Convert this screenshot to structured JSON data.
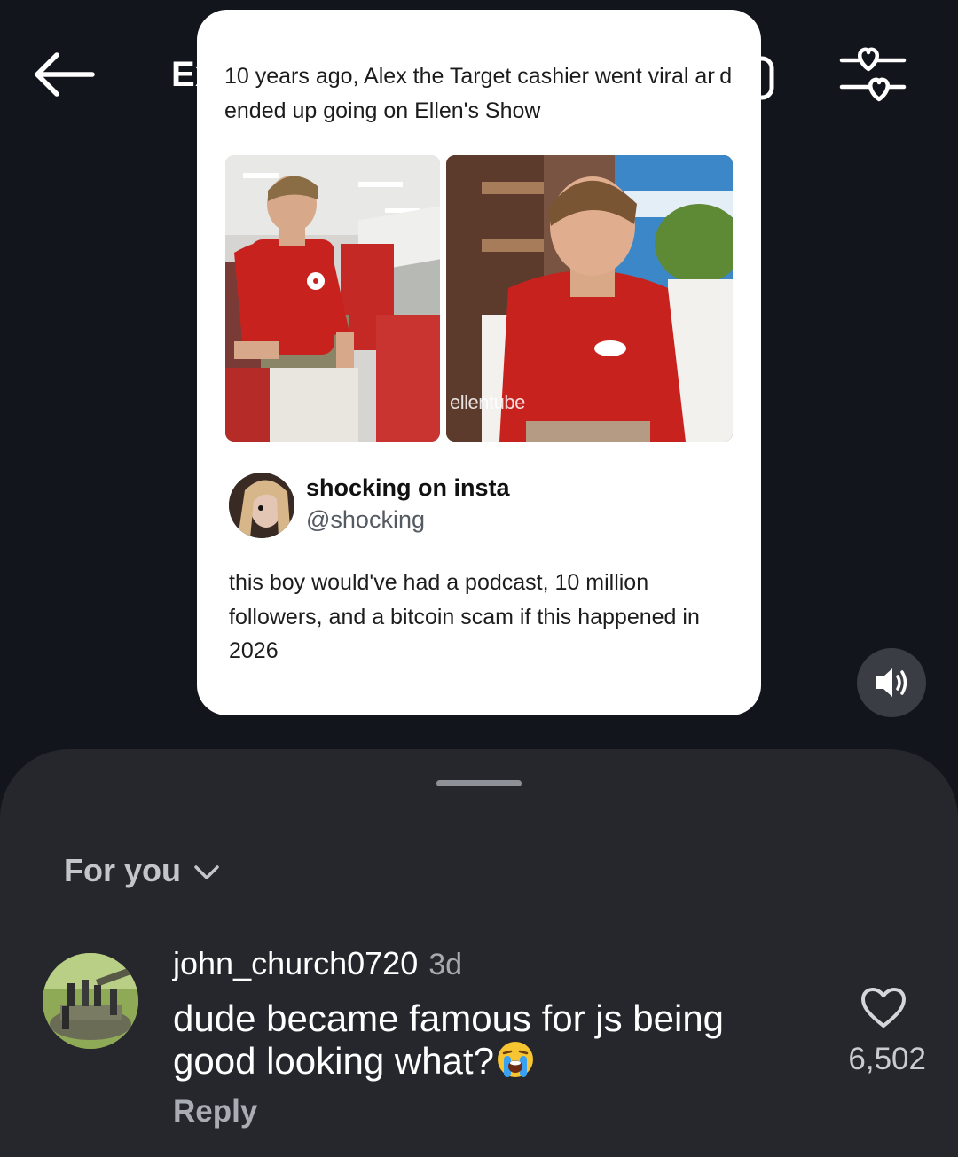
{
  "header": {
    "title": "Explore",
    "back_icon": "arrow-left-icon",
    "camera_icon": "camera-icon",
    "filter_icon": "heart-slider-filter-icon"
  },
  "post": {
    "headline": "10 years ago, Alex the Target cashier went viral and ended up going on Ellen's Show",
    "photo_left_watermark": "",
    "photo_right_watermark": "ellentube",
    "author_name": "shocking on insta",
    "author_handle": "@shocking",
    "tweet_text": "this boy would've had a podcast, 10 million followers, and a bitcoin scam if this happened in 2026"
  },
  "volume": {
    "icon": "volume-icon"
  },
  "comments": {
    "sort_label": "For you",
    "items": [
      {
        "username": "john_church0720",
        "time": "3d",
        "text": "dude became famous for js being good looking what?",
        "emoji": "loudly-crying-face",
        "reply_label": "Reply",
        "likes": "6,502"
      }
    ]
  },
  "colors": {
    "background": "#12151c",
    "sheet": "#25272d",
    "target_red": "#c8221f"
  }
}
